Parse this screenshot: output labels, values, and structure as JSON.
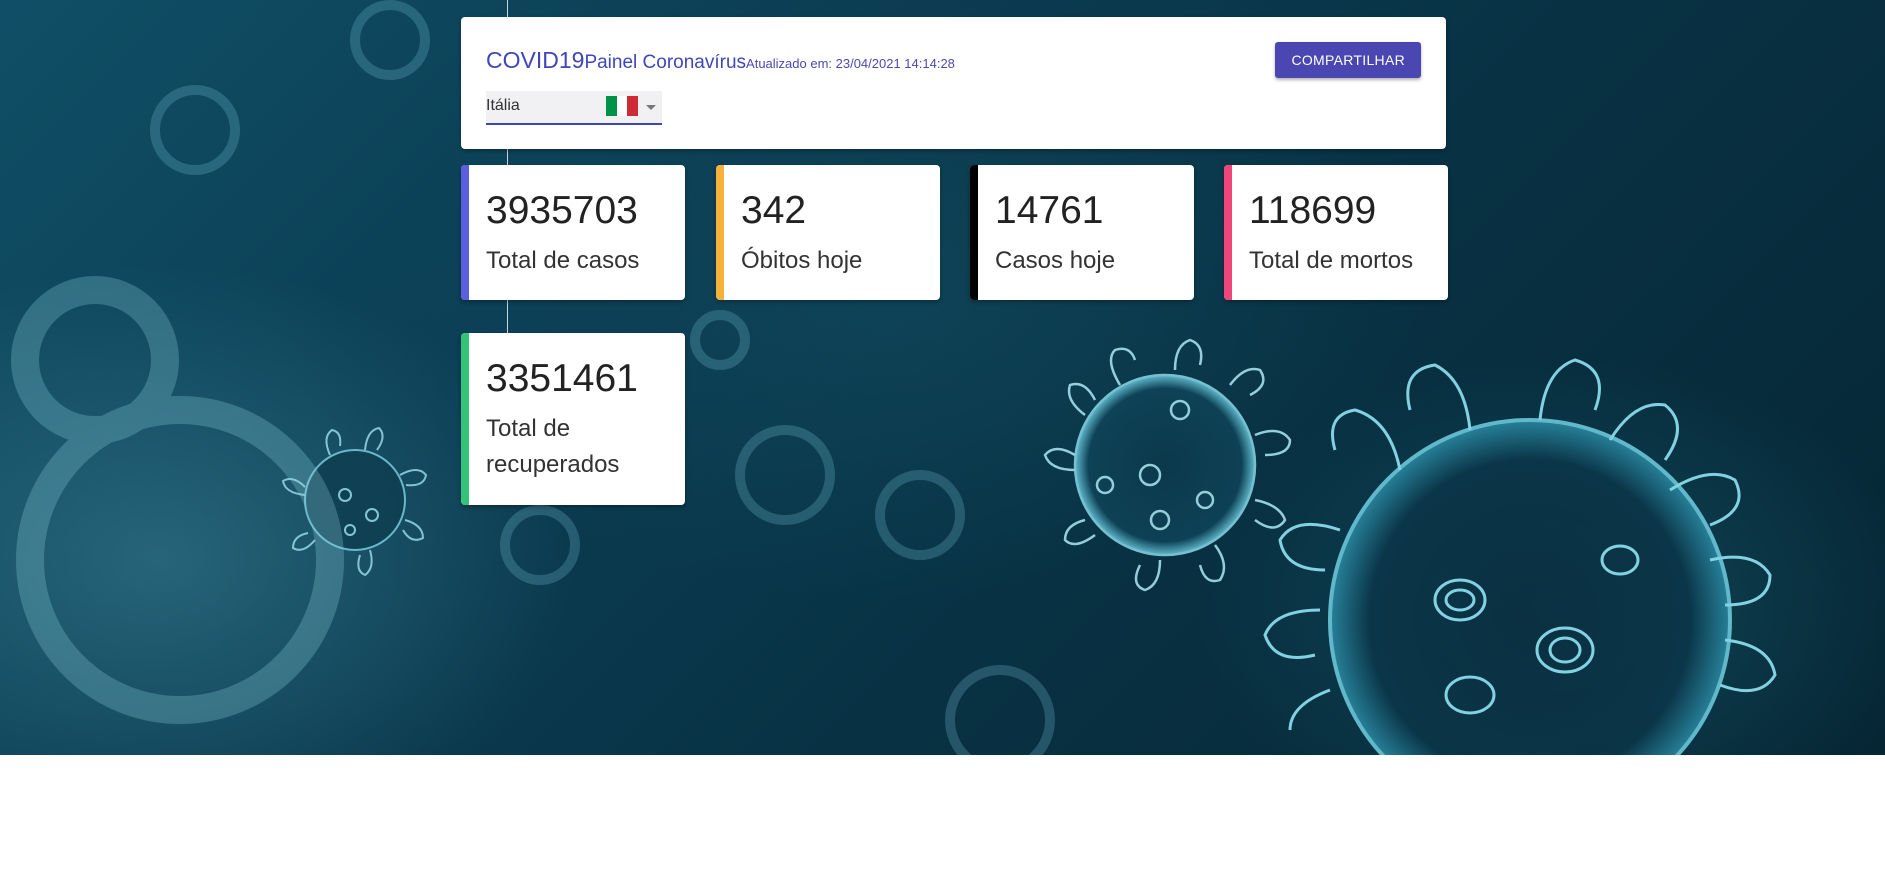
{
  "header": {
    "title_main": "COVID19",
    "title_sub": "Painel Coronavírus",
    "updated": "Atualizado em: 23/04/2021 14:14:28",
    "share_label": "COMPARTILHAR"
  },
  "country_select": {
    "selected": "Itália",
    "flag_icon": "italy-flag-icon",
    "flag_colors": [
      "#009246",
      "#ffffff",
      "#ce2b37"
    ]
  },
  "stats": [
    {
      "value": "3935703",
      "label": "Total de casos",
      "color": "#5a5fe0"
    },
    {
      "value": "342",
      "label": "Óbitos hoje",
      "color": "#f5b23a"
    },
    {
      "value": "14761",
      "label": "Casos hoje",
      "color": "#000000"
    },
    {
      "value": "118699",
      "label": "Total de mortos",
      "color": "#f0457a"
    },
    {
      "value": "3351461",
      "label": "Total de recuperados",
      "color": "#33c479"
    }
  ],
  "colors": {
    "primary": "#3f46b8",
    "button": "#4a47b2"
  }
}
